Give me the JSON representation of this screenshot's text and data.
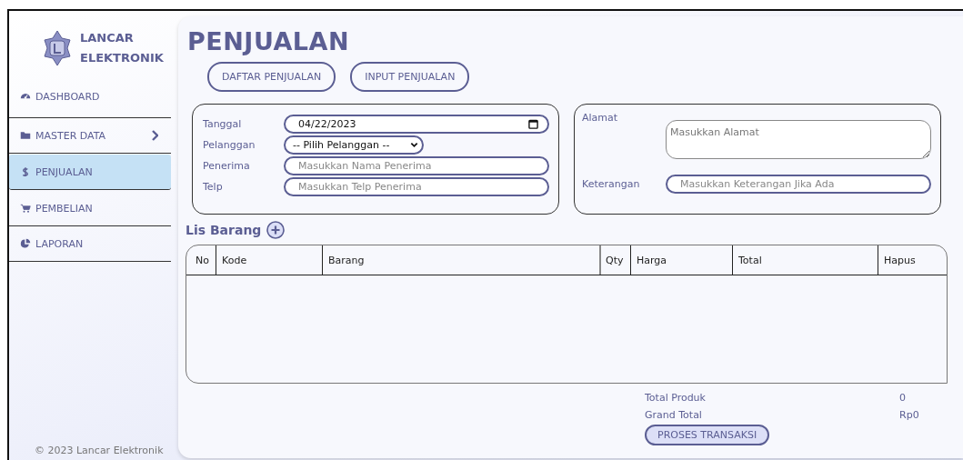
{
  "sidebar": {
    "brand": [
      "LANCAR",
      "ELEKTRONIK"
    ],
    "items": [
      {
        "label": "DASHBOARD",
        "selected": false,
        "submenu": false
      },
      {
        "label": "MASTER DATA",
        "selected": false,
        "submenu": true
      },
      {
        "label": "PENJUALAN",
        "selected": true,
        "submenu": false
      },
      {
        "label": "PEMBELIAN",
        "selected": false,
        "submenu": false
      },
      {
        "label": "LAPORAN",
        "selected": false,
        "submenu": false
      }
    ],
    "footer": "© 2023 Lancar Elektronik"
  },
  "page": {
    "title": "PENJUALAN",
    "tabs": [
      {
        "label": "DAFTAR PENJUALAN"
      },
      {
        "label": "INPUT PENJUALAN"
      }
    ]
  },
  "form_left": [
    {
      "label": "Tanggal",
      "kind": "date",
      "value": "04/22/2023"
    },
    {
      "label": "Pelanggan",
      "kind": "select",
      "value": "-- Pilih Pelanggan --"
    },
    {
      "label": "Penerima",
      "kind": "text",
      "placeholder": "Masukkan Nama Penerima"
    },
    {
      "label": "Telp",
      "kind": "text",
      "placeholder": "Masukkan Telp Penerima"
    }
  ],
  "form_right": [
    {
      "label": "Alamat",
      "kind": "textarea",
      "placeholder": "Masukkan Alamat"
    },
    {
      "label": "Keterangan",
      "kind": "text",
      "placeholder": "Masukkan Keterangan Jika Ada"
    }
  ],
  "items_section": {
    "title": "Lis Barang"
  },
  "table": {
    "columns": [
      "No",
      "Kode",
      "Barang",
      "Qty",
      "Harga",
      "Total",
      "Hapus"
    ]
  },
  "summary": [
    {
      "label": "Total Produk",
      "value": "0"
    },
    {
      "label": "Grand Total",
      "value": "Rp0"
    }
  ],
  "submit": "PROSES TRANSAKSI"
}
